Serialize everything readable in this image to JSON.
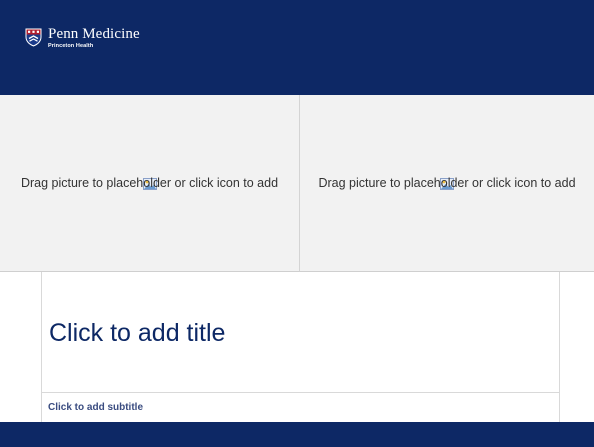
{
  "colors": {
    "brand_navy": "#0d2865",
    "placeholder_bg": "#f2f2f2",
    "subtitle_text": "#3a4c80"
  },
  "header": {
    "logo_name": "Penn Medicine",
    "logo_sub": "Princeton Health",
    "logo_icon": "penn-shield-icon"
  },
  "placeholders": [
    {
      "prompt": "Drag picture to placeholder or click icon to add",
      "icon": "insert-picture-icon"
    },
    {
      "prompt": "Drag picture to placeholder or click icon to add",
      "icon": "insert-picture-icon"
    }
  ],
  "title": {
    "text": "Click to add title"
  },
  "subtitle": {
    "text": "Click to add subtitle"
  }
}
